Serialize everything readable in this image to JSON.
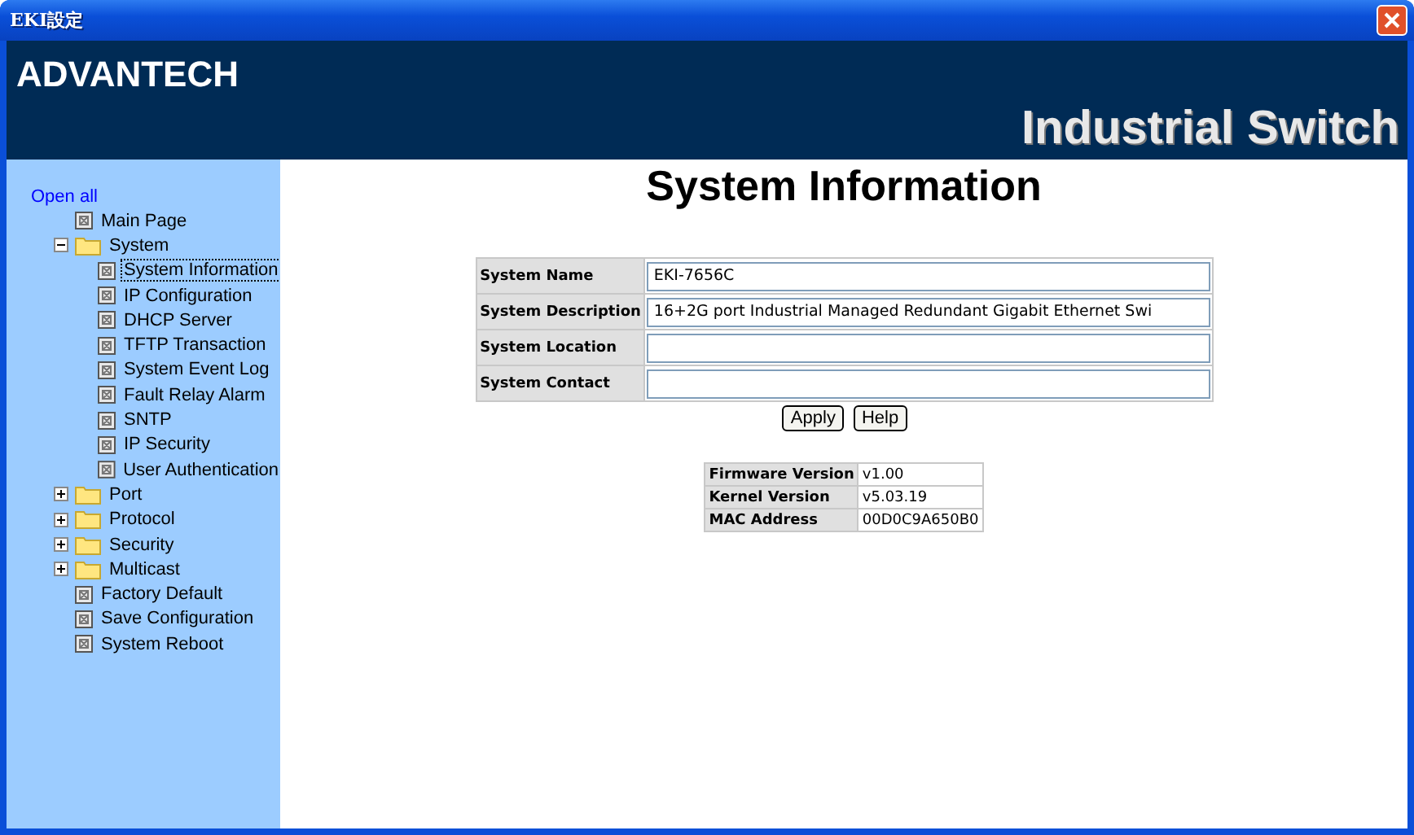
{
  "window": {
    "title": "EKI設定"
  },
  "header": {
    "logo": "ADVANTECH",
    "product": "Industrial Switch"
  },
  "sidebar": {
    "open_all": "Open all",
    "items": [
      {
        "kind": "page",
        "label": "Main Page",
        "selected": false
      },
      {
        "kind": "folder",
        "label": "System",
        "expanded": true,
        "selected": false,
        "children": [
          {
            "kind": "page",
            "label": "System Information",
            "selected": true
          },
          {
            "kind": "page",
            "label": "IP Configuration",
            "selected": false
          },
          {
            "kind": "page",
            "label": "DHCP Server",
            "selected": false
          },
          {
            "kind": "page",
            "label": "TFTP Transaction",
            "selected": false
          },
          {
            "kind": "page",
            "label": "System Event Log",
            "selected": false
          },
          {
            "kind": "page",
            "label": "Fault Relay Alarm",
            "selected": false
          },
          {
            "kind": "page",
            "label": "SNTP",
            "selected": false
          },
          {
            "kind": "page",
            "label": "IP Security",
            "selected": false
          },
          {
            "kind": "page",
            "label": "User Authentication",
            "selected": false
          }
        ]
      },
      {
        "kind": "folder",
        "label": "Port",
        "expanded": false,
        "selected": false
      },
      {
        "kind": "folder",
        "label": "Protocol",
        "expanded": false,
        "selected": false
      },
      {
        "kind": "folder",
        "label": "Security",
        "expanded": false,
        "selected": false
      },
      {
        "kind": "folder",
        "label": "Multicast",
        "expanded": false,
        "selected": false
      },
      {
        "kind": "page",
        "label": "Factory Default",
        "selected": false
      },
      {
        "kind": "page",
        "label": "Save Configuration",
        "selected": false
      },
      {
        "kind": "page",
        "label": "System Reboot",
        "selected": false
      }
    ]
  },
  "page": {
    "title": "System Information",
    "form": [
      {
        "label": "System Name",
        "value": "EKI-7656C"
      },
      {
        "label": "System Description",
        "value": "16+2G port Industrial Managed Redundant Gigabit Ethernet Swi"
      },
      {
        "label": "System Location"
      },
      {
        "label": "System Contact"
      }
    ],
    "buttons": [
      "Apply",
      "Help"
    ],
    "info": [
      {
        "label": "Firmware Version",
        "value": "v1.00"
      },
      {
        "label": "Kernel Version",
        "value": "v5.03.19"
      },
      {
        "label": "MAC Address",
        "value": "00D0C9A650B0"
      }
    ]
  }
}
